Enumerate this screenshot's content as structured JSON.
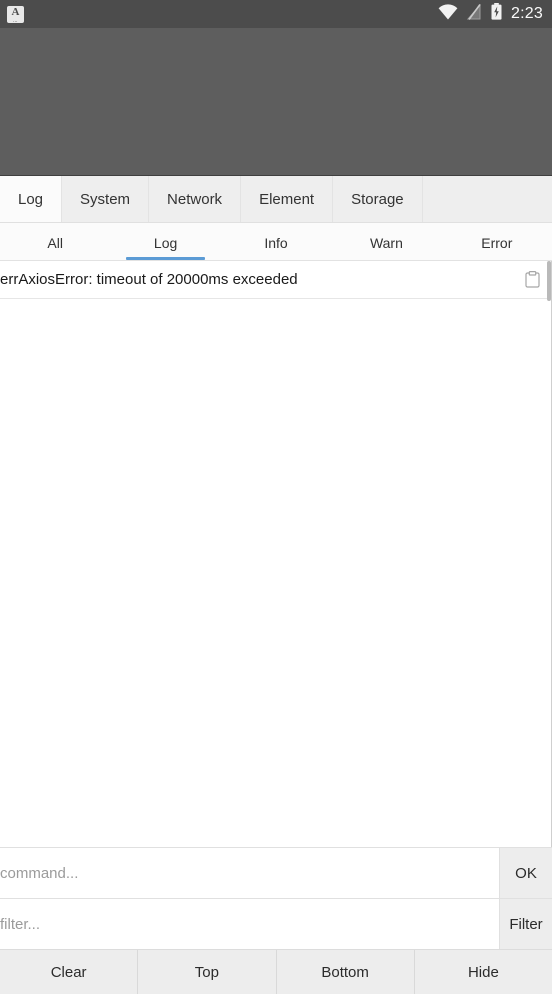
{
  "statusbar": {
    "notification_icon": "app-letter-a-icon",
    "wifi_icon": "wifi-icon",
    "signal_off_icon": "signal-no-service-icon",
    "battery_icon": "battery-charging-icon",
    "clock": "2:23"
  },
  "panel": {
    "main_tabs": [
      {
        "label": "Log",
        "active": true
      },
      {
        "label": "System",
        "active": false
      },
      {
        "label": "Network",
        "active": false
      },
      {
        "label": "Element",
        "active": false
      },
      {
        "label": "Storage",
        "active": false
      }
    ],
    "sub_tabs": [
      {
        "label": "All",
        "active": false
      },
      {
        "label": "Log",
        "active": true
      },
      {
        "label": "Info",
        "active": false
      },
      {
        "label": "Warn",
        "active": false
      },
      {
        "label": "Error",
        "active": false
      }
    ],
    "accent_color": "#5b9bd5",
    "log_entries": [
      {
        "message": "errAxiosError: timeout of 20000ms exceeded",
        "copy_icon": "clipboard-copy-icon"
      }
    ],
    "command": {
      "placeholder": "command...",
      "value": "",
      "button_label": "OK"
    },
    "filter": {
      "placeholder": "filter...",
      "value": "",
      "button_label": "Filter"
    },
    "bottom_buttons": [
      {
        "label": "Clear"
      },
      {
        "label": "Top"
      },
      {
        "label": "Bottom"
      },
      {
        "label": "Hide"
      }
    ]
  }
}
